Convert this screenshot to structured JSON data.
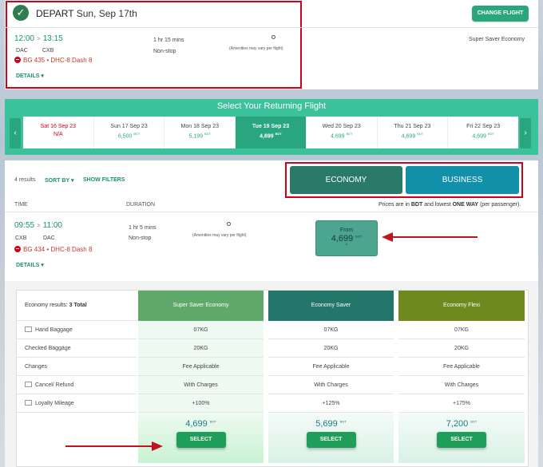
{
  "depart": {
    "label": "DEPART",
    "date": "Sun, Sep 17th",
    "depart_time": "12:00",
    "arrive_time": "13:15",
    "origin": "DAC",
    "destination": "CXB",
    "flight_no": "BG 435",
    "aircraft": "DHC-8 Dash 8",
    "duration": "1 hr 15 mins",
    "stops": "Non-stop",
    "amenities": "(Amenities may vary per flight)",
    "details": "DETAILS",
    "fare_class": "Super Saver Economy",
    "change_button": "CHANGE FLIGHT"
  },
  "returning": {
    "title": "Select Your Returning Flight",
    "prev_icon": "chevron-left-icon",
    "next_icon": "chevron-right-icon",
    "dates": [
      {
        "date": "Sat 16 Sep 23",
        "price": "N/A",
        "currency": "",
        "state": "na"
      },
      {
        "date": "Sun 17 Sep 23",
        "price": "6,500",
        "currency": "BDT",
        "state": "normal"
      },
      {
        "date": "Mon 18 Sep 23",
        "price": "5,199",
        "currency": "BDT",
        "state": "normal"
      },
      {
        "date": "Tue 19 Sep 23",
        "price": "4,699",
        "currency": "BDT",
        "state": "selected"
      },
      {
        "date": "Wed 20 Sep 23",
        "price": "4,699",
        "currency": "BDT",
        "state": "normal"
      },
      {
        "date": "Thu 21 Sep 23",
        "price": "4,699",
        "currency": "BDT",
        "state": "normal"
      },
      {
        "date": "Fri 22 Sep 23",
        "price": "4,699",
        "currency": "BDT",
        "state": "normal"
      }
    ]
  },
  "results": {
    "count": "4 results",
    "sort_by": "SORT BY",
    "show_filters": "SHOW FILTERS",
    "tab_economy": "ECONOMY",
    "tab_business": "BUSINESS",
    "col_time": "TIME",
    "col_duration": "DURATION",
    "price_note": "Prices are in BDT and lowest ONE WAY (per passenger).",
    "price_note_pre": "Prices are in ",
    "price_note_bdt": "BDT",
    "price_note_mid": " and lowest ",
    "price_note_oneway": "ONE WAY",
    "price_note_post": " (per passenger)."
  },
  "flight": {
    "depart_time": "09:55",
    "arrive_time": "11:00",
    "origin": "CXB",
    "destination": "DAC",
    "flight_no": "BG 434",
    "aircraft": "DHC-8 Dash 8",
    "duration": "1 hr 5 mins",
    "stops": "Non-stop",
    "amenities": "(Amenities may vary per flight)",
    "details": "DETAILS",
    "from_label": "From",
    "from_price": "4,699",
    "currency": "BDT"
  },
  "fare_table": {
    "results_label": "Economy results:",
    "results_total": "3 Total",
    "rows": [
      "Hand Baggage",
      "Checked Baggage",
      "Changes",
      "Cancel/ Refund",
      "Loyalty Mileage"
    ],
    "columns": [
      {
        "name": "Super Saver Economy",
        "color": "#5faa6a",
        "values": [
          "07KG",
          "20KG",
          "Fee Applicable",
          "With Charges",
          "+100%"
        ],
        "price": "4,699",
        "currency": "BDT",
        "select": "SELECT"
      },
      {
        "name": "Economy Saver",
        "color": "#25766a",
        "values": [
          "07KG",
          "20KG",
          "Fee Applicable",
          "With Charges",
          "+125%"
        ],
        "price": "5,699",
        "currency": "BDT",
        "select": "SELECT"
      },
      {
        "name": "Economy Flexi",
        "color": "#6e8a1f",
        "values": [
          "07KG",
          "20KG",
          "Fee Applicable",
          "With Charges",
          "+175%"
        ],
        "price": "7,200",
        "currency": "BDT",
        "select": "SELECT"
      }
    ]
  }
}
